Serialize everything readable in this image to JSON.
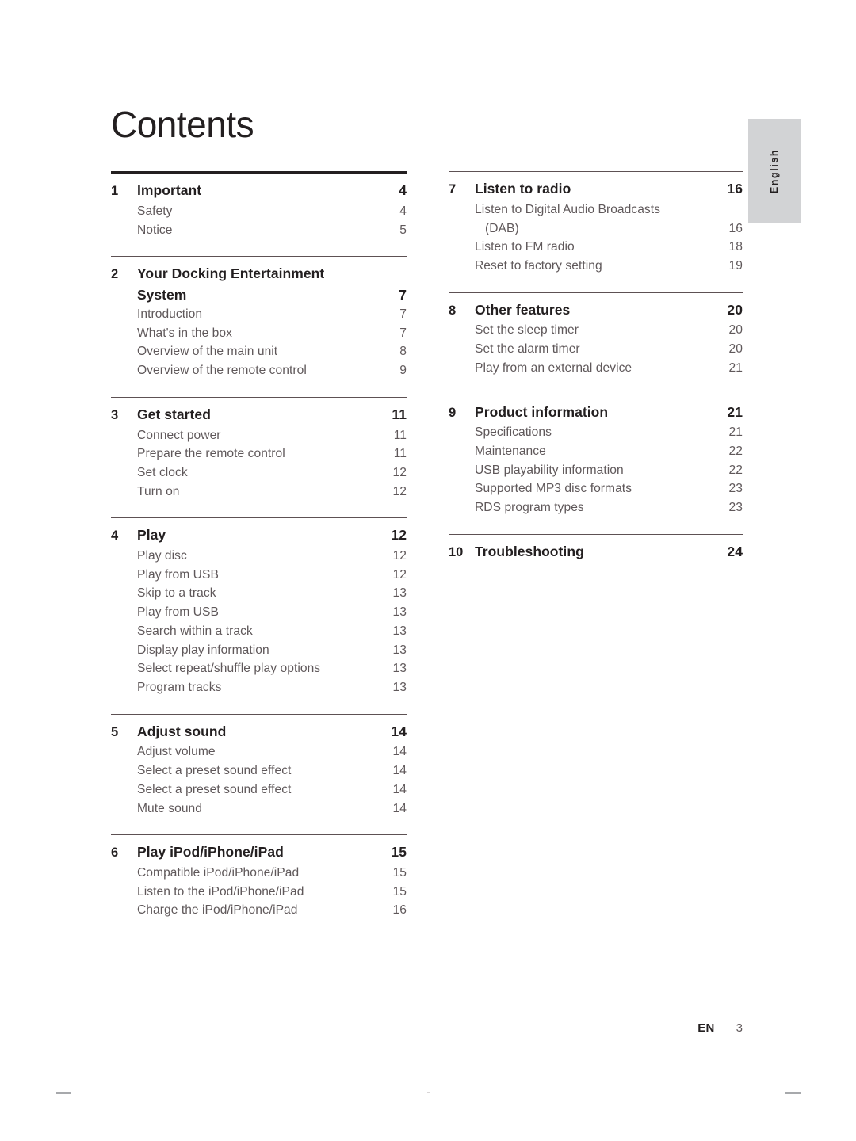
{
  "page_title": "Contents",
  "language_tab": {
    "label": "English"
  },
  "footer": {
    "locale": "EN",
    "page_number": "3"
  },
  "columns": {
    "left": [
      {
        "rule": "thick",
        "number": "1",
        "heading": "Important",
        "heading_page": "4",
        "items": [
          {
            "label": "Safety",
            "page": "4"
          },
          {
            "label": "Notice",
            "page": "5"
          }
        ]
      },
      {
        "rule": "thin",
        "number": "2",
        "heading": "Your Docking Entertainment",
        "heading_page": "",
        "heading_cont": "System",
        "heading_cont_page": "7",
        "items": [
          {
            "label": "Introduction",
            "page": "7"
          },
          {
            "label": "What's in the box",
            "page": "7"
          },
          {
            "label": "Overview of the main unit",
            "page": "8"
          },
          {
            "label": "Overview of the remote control",
            "page": "9"
          }
        ]
      },
      {
        "rule": "thin",
        "number": "3",
        "heading": "Get started",
        "heading_page": "11",
        "items": [
          {
            "label": "Connect power",
            "page": "11"
          },
          {
            "label": "Prepare the remote control",
            "page": "11"
          },
          {
            "label": "Set clock",
            "page": "12"
          },
          {
            "label": "Turn on",
            "page": "12"
          }
        ]
      },
      {
        "rule": "thin",
        "number": "4",
        "heading": "Play",
        "heading_page": "12",
        "items": [
          {
            "label": "Play disc",
            "page": "12"
          },
          {
            "label": "Play from USB",
            "page": "12"
          },
          {
            "label": "Skip to a track",
            "page": "13"
          },
          {
            "label": "Play from USB",
            "page": "13"
          },
          {
            "label": "Search within a track",
            "page": "13"
          },
          {
            "label": "Display play information",
            "page": "13"
          },
          {
            "label": "Select repeat/shuffle play options",
            "page": "13"
          },
          {
            "label": "Program tracks",
            "page": "13"
          }
        ]
      },
      {
        "rule": "thin",
        "number": "5",
        "heading": "Adjust sound",
        "heading_page": "14",
        "items": [
          {
            "label": "Adjust volume",
            "page": "14"
          },
          {
            "label": "Select a preset sound effect",
            "page": "14"
          },
          {
            "label": "Select a preset sound effect",
            "page": "14"
          },
          {
            "label": "Mute sound",
            "page": "14"
          }
        ]
      },
      {
        "rule": "thin",
        "number": "6",
        "heading": "Play iPod/iPhone/iPad",
        "heading_page": "15",
        "items": [
          {
            "label": "Compatible iPod/iPhone/iPad",
            "page": "15"
          },
          {
            "label": "Listen to the iPod/iPhone/iPad",
            "page": "15"
          },
          {
            "label": "Charge the iPod/iPhone/iPad",
            "page": "16"
          }
        ]
      }
    ],
    "right": [
      {
        "rule": "thin",
        "number": "7",
        "heading": "Listen to radio",
        "heading_page": "16",
        "items": [
          {
            "label": "Listen to Digital Audio Broadcasts",
            "page": ""
          },
          {
            "label": "(DAB)",
            "page": "16",
            "indent": true
          },
          {
            "label": "Listen to FM radio",
            "page": "18"
          },
          {
            "label": "Reset to factory setting",
            "page": "19"
          }
        ]
      },
      {
        "rule": "thin",
        "number": "8",
        "heading": "Other features",
        "heading_page": "20",
        "items": [
          {
            "label": "Set the sleep timer",
            "page": "20"
          },
          {
            "label": "Set the alarm timer",
            "page": "20"
          },
          {
            "label": "Play from an external device",
            "page": "21"
          }
        ]
      },
      {
        "rule": "thin",
        "number": "9",
        "heading": "Product information",
        "heading_page": "21",
        "items": [
          {
            "label": "Specifications",
            "page": "21"
          },
          {
            "label": "Maintenance",
            "page": "22"
          },
          {
            "label": "USB playability information",
            "page": "22"
          },
          {
            "label": "Supported MP3 disc formats",
            "page": "23"
          },
          {
            "label": "RDS program types",
            "page": "23"
          }
        ]
      },
      {
        "rule": "thin",
        "number": "10",
        "heading": "Troubleshooting",
        "heading_page": "24",
        "items": []
      }
    ]
  }
}
